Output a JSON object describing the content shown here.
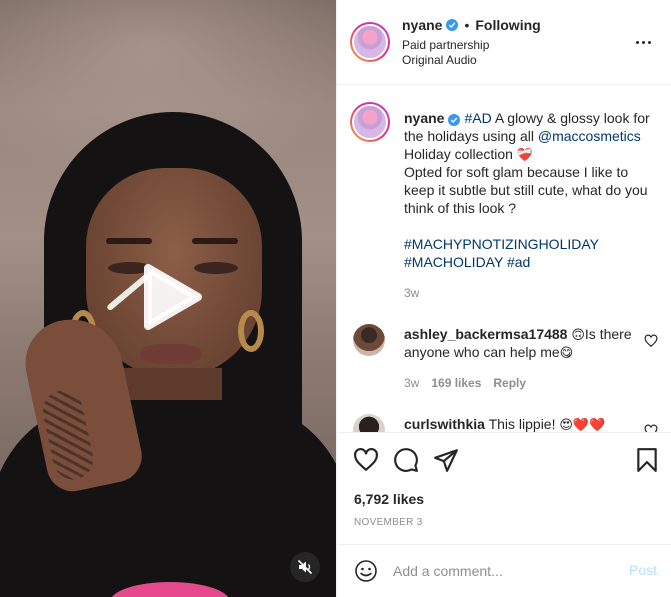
{
  "post": {
    "username": "nyane",
    "follow_status": "Following",
    "separator": "•",
    "paid_partnership": "Paid partnership",
    "audio": "Original Audio"
  },
  "caption": {
    "username": "nyane",
    "tag_ad": "#AD",
    "line1_text": "A glowy & glossy look for the holidays using all",
    "mention": "@maccosmetics",
    "line2_text": "Holiday collection",
    "line2_emoji": "❤️‍🩹",
    "line3": "Opted for soft glam because I like to keep it subtle but still cute, what do you think of this look ?",
    "hashtag1": "#MACHYPNOTIZINGHOLIDAY",
    "hashtag2": "#MACHOLIDAY",
    "hashtag3": "#ad",
    "time": "3w"
  },
  "comments": [
    {
      "username": "ashley_backermsa17488",
      "emoji_before": "🙃",
      "text": "Is there anyone who can help me",
      "emoji_after": "😋",
      "time": "3w",
      "likes": "169 likes",
      "reply": "Reply"
    },
    {
      "username": "curlswithkia",
      "text": "This lippie!",
      "emojis": "😍❤️❤️"
    }
  ],
  "stats": {
    "likes": "6,792 likes",
    "date": "NOVEMBER 3"
  },
  "composer": {
    "placeholder": "Add a comment...",
    "post_label": "Post"
  },
  "icons": {
    "play": "play-icon",
    "mute": "muted-speaker-icon",
    "verified": "verified-badge-icon",
    "more": "more-options-icon",
    "like": "heart-icon",
    "comment": "comment-bubble-icon",
    "share": "paper-plane-icon",
    "save": "bookmark-icon",
    "emoji": "smiley-face-icon"
  },
  "colors": {
    "link": "#00376b",
    "verified": "#3897f0",
    "post_disabled": "#b2dffc",
    "secondary_text": "#8e8e8e"
  }
}
